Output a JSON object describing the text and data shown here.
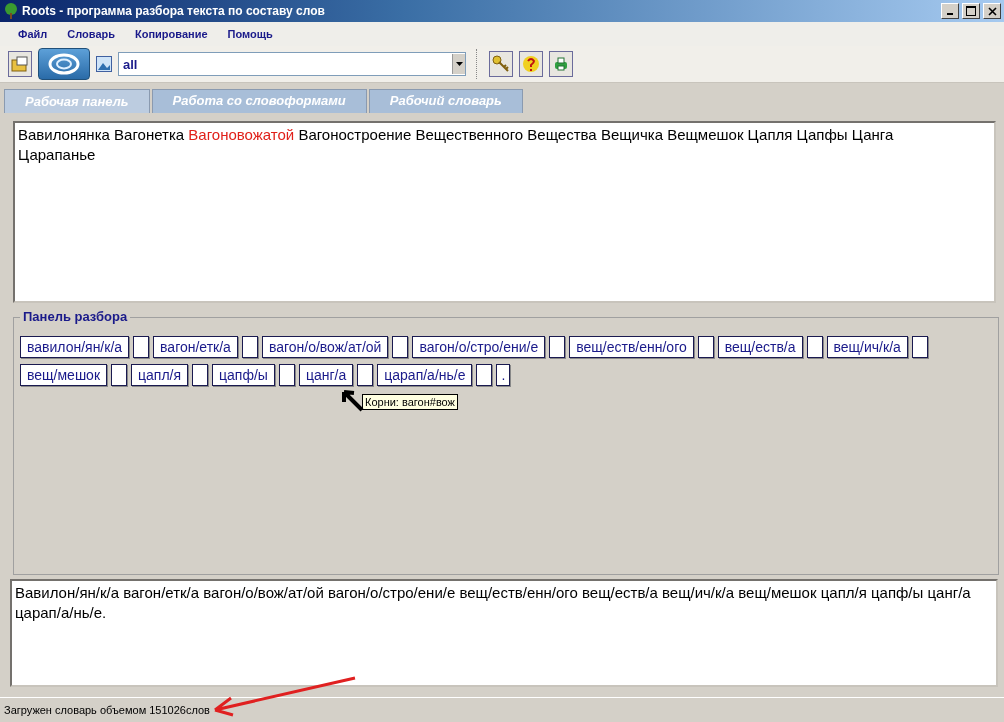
{
  "window": {
    "title": "Roots - программа разбора текста по составу слов"
  },
  "menu": [
    "Файл",
    "Словарь",
    "Копирование",
    "Помощь"
  ],
  "toolbar": {
    "filter": {
      "value": "all"
    }
  },
  "tabs": [
    {
      "label": "Рабочая панель",
      "selected": true
    },
    {
      "label": "Работа со словоформами",
      "selected": false
    },
    {
      "label": "Рабочий словарь",
      "selected": false
    }
  ],
  "source_text": [
    {
      "text": "Вавилонянка Вагонетка",
      "highlighted": false
    },
    {
      "text": "Вагоновожатой",
      "highlighted": true
    },
    {
      "text": "Вагоностроение Вещественного Вещества Вещичка Вещмешок Цапля Цапфы Цанга",
      "highlighted": false
    },
    {
      "text": "Царапанье",
      "highlighted": false
    }
  ],
  "parse_panel": {
    "title": "Панель разбора",
    "items": [
      {
        "kind": "word",
        "text": "вавилон/ян/к/а"
      },
      {
        "kind": "gap"
      },
      {
        "kind": "word",
        "text": "вагон/етк/а"
      },
      {
        "kind": "gap"
      },
      {
        "kind": "word",
        "text": "вагон/о/вож/ат/ой"
      },
      {
        "kind": "gap"
      },
      {
        "kind": "word",
        "text": "вагон/о/стро/ени/е"
      },
      {
        "kind": "gap"
      },
      {
        "kind": "word",
        "text": "вещ/еств/енн/ого"
      },
      {
        "kind": "gap"
      },
      {
        "kind": "word",
        "text": "вещ/еств/а"
      },
      {
        "kind": "gap"
      },
      {
        "kind": "word",
        "text": "вещ/ич/к/а"
      },
      {
        "kind": "gap"
      },
      {
        "kind": "word",
        "text": "вещ/мешок"
      },
      {
        "kind": "gap"
      },
      {
        "kind": "word",
        "text": "цапл/я"
      },
      {
        "kind": "gap"
      },
      {
        "kind": "word",
        "text": "цапф/ы"
      },
      {
        "kind": "gap"
      },
      {
        "kind": "word",
        "text": "цанг/а"
      },
      {
        "kind": "gap"
      },
      {
        "kind": "word",
        "text": "царап/а/нь/е"
      },
      {
        "kind": "gap"
      },
      {
        "kind": "punct",
        "text": "."
      }
    ],
    "tooltip": "Корни: вагон#вож"
  },
  "result_text": "Вавилон/ян/к/а вагон/етк/а вагон/о/вож/ат/ой вагон/о/стро/ени/е вещ/еств/енн/ого вещ/еств/а вещ/ич/к/а вещ/мешок цапл/я цапф/ы цанг/а царап/а/нь/е.",
  "status_bar": "Загружен словарь объемом 151026слов"
}
